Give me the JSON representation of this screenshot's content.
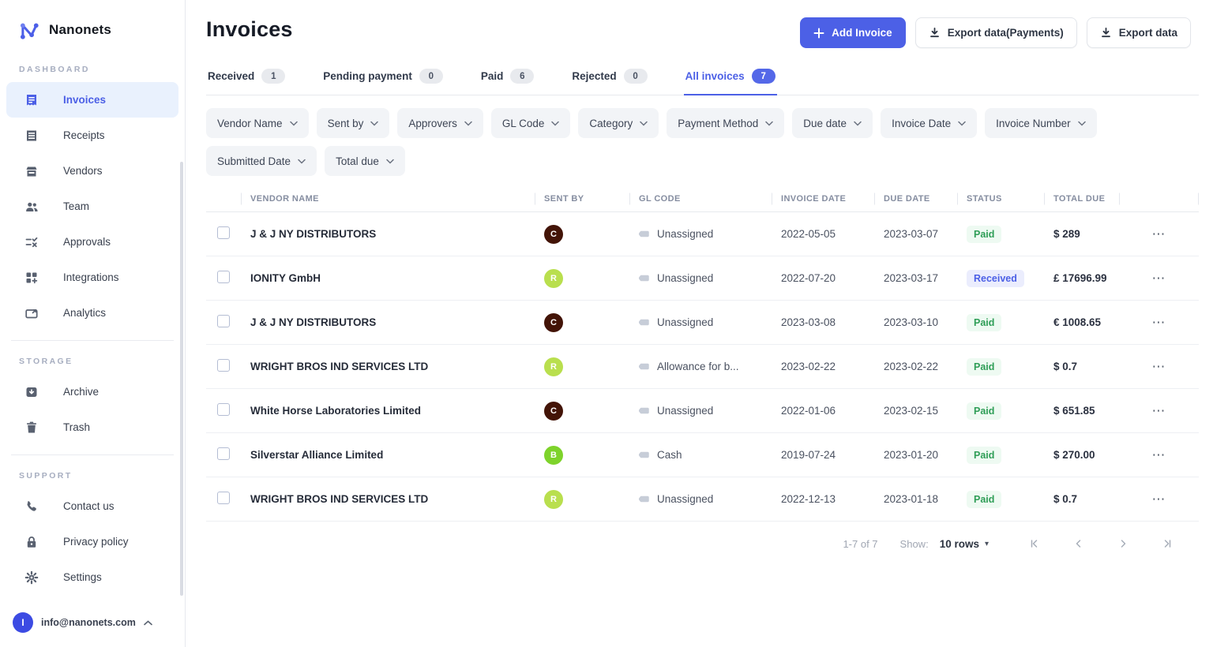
{
  "colors": {
    "accent": "#4c60e6",
    "sidebar_active_bg": "#e9f1fd",
    "tab_badge_bg": "#e8eaee",
    "tab_badge_active_bg": "#5468e8",
    "paid_text": "#2f9e57",
    "paid_bg": "#eefaf2",
    "received_text": "#4c60e6",
    "received_bg": "#ebedfd"
  },
  "icons": {
    "row_menu": "⋯",
    "caret_down": "▾"
  },
  "sidebar": {
    "brand": "Nanonets",
    "sections": [
      {
        "title": "DASHBOARD",
        "items": [
          {
            "label": "Invoices",
            "active": "true"
          },
          {
            "label": "Receipts"
          },
          {
            "label": "Vendors"
          },
          {
            "label": "Team"
          },
          {
            "label": "Approvals"
          },
          {
            "label": "Integrations"
          },
          {
            "label": "Analytics"
          }
        ]
      },
      {
        "title": "STORAGE",
        "items": [
          {
            "label": "Archive"
          },
          {
            "label": "Trash"
          }
        ]
      },
      {
        "title": "SUPPORT",
        "items": [
          {
            "label": "Contact us"
          },
          {
            "label": "Privacy policy"
          },
          {
            "label": "Settings"
          }
        ]
      }
    ],
    "account": {
      "email": "info@nanonets.com",
      "avatar_letter": "I",
      "avatar_color": "#3c4be3"
    }
  },
  "header": {
    "title": "Invoices",
    "buttons": {
      "add": "Add Invoice",
      "export_payments": "Export data(Payments)",
      "export": "Export data"
    }
  },
  "tabs": [
    {
      "label": "Received",
      "count": "1"
    },
    {
      "label": "Pending payment",
      "count": "0"
    },
    {
      "label": "Paid",
      "count": "6"
    },
    {
      "label": "Rejected",
      "count": "0"
    },
    {
      "label": "All invoices",
      "count": "7",
      "active": "true"
    }
  ],
  "filters": [
    "Vendor Name",
    "Sent by",
    "Approvers",
    "GL Code",
    "Category",
    "Payment Method",
    "Due date",
    "Invoice Date",
    "Invoice Number",
    "Submitted Date",
    "Total due"
  ],
  "table": {
    "columns": [
      "VENDOR NAME",
      "SENT BY",
      "GL CODE",
      "INVOICE DATE",
      "DUE DATE",
      "STATUS",
      "TOTAL DUE"
    ],
    "rows": [
      {
        "vendor": "J & J NY DISTRIBUTORS",
        "sent_by_letter": "C",
        "sent_by_color": "#431407",
        "gl_code": "Unassigned",
        "invoice_date": "2022-05-05",
        "due_date": "2023-03-07",
        "status_label": "Paid",
        "status_variant": "paid",
        "total_due": "$ 289"
      },
      {
        "vendor": "IONITY GmbH",
        "sent_by_letter": "R",
        "sent_by_color": "#b9df4e",
        "gl_code": "Unassigned",
        "invoice_date": "2022-07-20",
        "due_date": "2023-03-17",
        "status_label": "Received",
        "status_variant": "received",
        "total_due": "£ 17696.99"
      },
      {
        "vendor": "J & J NY DISTRIBUTORS",
        "sent_by_letter": "C",
        "sent_by_color": "#431407",
        "gl_code": "Unassigned",
        "invoice_date": "2023-03-08",
        "due_date": "2023-03-10",
        "status_label": "Paid",
        "status_variant": "paid",
        "total_due": "€ 1008.65"
      },
      {
        "vendor": "WRIGHT BROS IND SERVICES LTD",
        "sent_by_letter": "R",
        "sent_by_color": "#b9df4e",
        "gl_code": "Allowance for b...",
        "invoice_date": "2023-02-22",
        "due_date": "2023-02-22",
        "status_label": "Paid",
        "status_variant": "paid",
        "total_due": "$ 0.7"
      },
      {
        "vendor": "White Horse Laboratories Limited",
        "sent_by_letter": "C",
        "sent_by_color": "#431407",
        "gl_code": "Unassigned",
        "invoice_date": "2022-01-06",
        "due_date": "2023-02-15",
        "status_label": "Paid",
        "status_variant": "paid",
        "total_due": "$ 651.85"
      },
      {
        "vendor": "Silverstar Alliance Limited",
        "sent_by_letter": "B",
        "sent_by_color": "#7ed32b",
        "gl_code": "Cash",
        "invoice_date": "2019-07-24",
        "due_date": "2023-01-20",
        "status_label": "Paid",
        "status_variant": "paid",
        "total_due": "$ 270.00"
      },
      {
        "vendor": "WRIGHT BROS IND SERVICES LTD",
        "sent_by_letter": "R",
        "sent_by_color": "#b9df4e",
        "gl_code": "Unassigned",
        "invoice_date": "2022-12-13",
        "due_date": "2023-01-18",
        "status_label": "Paid",
        "status_variant": "paid",
        "total_due": "$ 0.7"
      }
    ]
  },
  "pagination": {
    "range": "1-7 of 7",
    "show_label": "Show:",
    "rows_option": "10 rows"
  }
}
